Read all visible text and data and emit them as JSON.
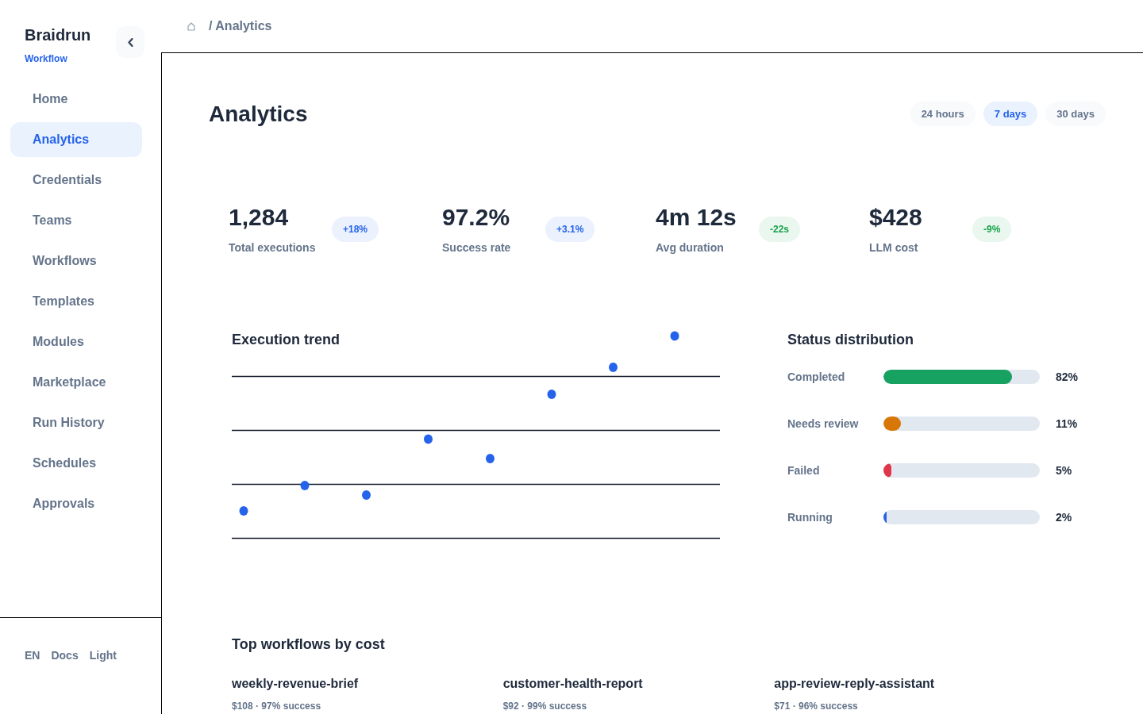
{
  "sidebar": {
    "brand": "Braidrun",
    "subtitle": "Workflow",
    "items": [
      {
        "label": "Home",
        "selected": false
      },
      {
        "label": "Analytics",
        "selected": true
      },
      {
        "label": "Credentials",
        "selected": false
      },
      {
        "label": "Teams",
        "selected": false
      },
      {
        "label": "Workflows",
        "selected": false
      },
      {
        "label": "Templates",
        "selected": false
      },
      {
        "label": "Modules",
        "selected": false
      },
      {
        "label": "Marketplace",
        "selected": false
      },
      {
        "label": "Run History",
        "selected": false
      },
      {
        "label": "Schedules",
        "selected": false
      },
      {
        "label": "Approvals",
        "selected": false
      }
    ],
    "footer_links": [
      "EN",
      "Docs",
      "Light"
    ]
  },
  "breadcrumb": {
    "current": "/ Analytics"
  },
  "page": {
    "title": "Analytics",
    "ranges": [
      {
        "label": "24 hours",
        "selected": false
      },
      {
        "label": "7 days",
        "selected": true
      },
      {
        "label": "30 days",
        "selected": false
      }
    ]
  },
  "stats": [
    {
      "value": "1,284",
      "label": "Total executions",
      "change": {
        "text": "+18%",
        "color": "#2563eb"
      }
    },
    {
      "value": "97.2%",
      "label": "Success rate",
      "change": {
        "text": "+3.1%",
        "color": "#2563eb"
      }
    },
    {
      "value": "4m 12s",
      "label": "Avg duration",
      "change": {
        "text": "-22s",
        "color": "#16a34a"
      }
    },
    {
      "value": "$428",
      "label": "LLM cost",
      "change": {
        "text": "-9%",
        "color": "#16a34a"
      }
    }
  ],
  "execution_trend": {
    "title": "Execution trend"
  },
  "status_distribution": {
    "title": "Status distribution",
    "rows": [
      {
        "label": "Completed",
        "level": 0.82,
        "color": "#17a262",
        "reading": "82%"
      },
      {
        "label": "Needs review",
        "level": 0.11,
        "color": "#d97706",
        "reading": "11%"
      },
      {
        "label": "Failed",
        "level": 0.05,
        "color": "#e0364a",
        "reading": "5%"
      },
      {
        "label": "Running",
        "level": 0.02,
        "color": "#2563eb",
        "reading": "2%"
      }
    ]
  },
  "top_workflows": {
    "title": "Top workflows by cost",
    "items": [
      {
        "name": "weekly-revenue-brief",
        "detail": "$108 · 97% success"
      },
      {
        "name": "customer-health-report",
        "detail": "$92 · 99% success"
      },
      {
        "name": "app-review-reply-assistant",
        "detail": "$71 · 96% success"
      }
    ]
  }
}
